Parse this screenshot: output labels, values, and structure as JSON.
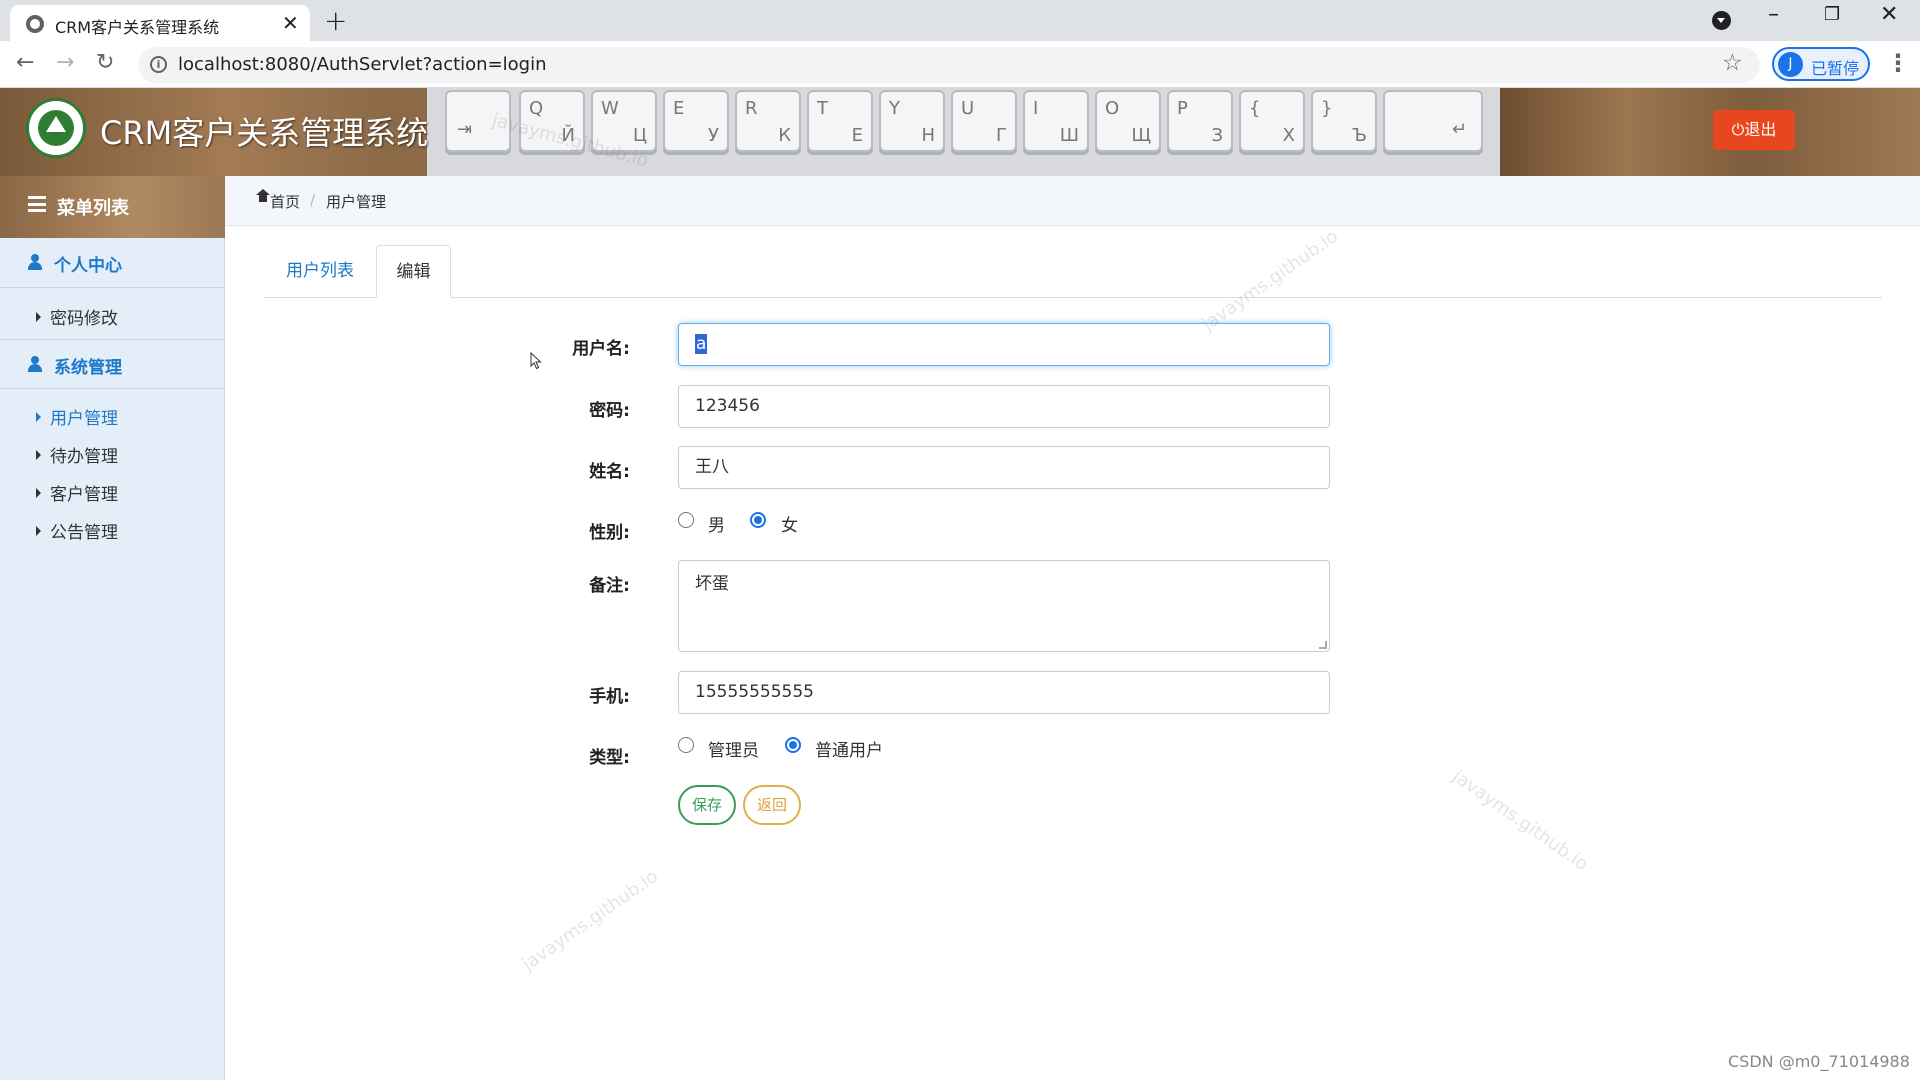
{
  "browser": {
    "tab_title": "CRM客户关系管理系统",
    "url": "localhost:8080/AuthServlet?action=login",
    "profile_initial": "J",
    "profile_status": "已暂停"
  },
  "header": {
    "app_title": "CRM客户关系管理系统",
    "logout_label": "退出"
  },
  "sidebar": {
    "menu_title": "菜单列表",
    "sections": [
      {
        "label": "个人中心",
        "items": [
          {
            "label": "密码修改"
          }
        ]
      },
      {
        "label": "系统管理",
        "items": [
          {
            "label": "用户管理",
            "active": true
          },
          {
            "label": "待办管理"
          },
          {
            "label": "客户管理"
          },
          {
            "label": "公告管理"
          }
        ]
      }
    ]
  },
  "breadcrumb": {
    "home": "首页",
    "current": "用户管理"
  },
  "tabs": [
    {
      "label": "用户列表"
    },
    {
      "label": "编辑",
      "active": true
    }
  ],
  "form": {
    "username": {
      "label": "用户名:",
      "value": "a"
    },
    "password": {
      "label": "密码:",
      "value": "123456"
    },
    "name": {
      "label": "姓名:",
      "value": "王八"
    },
    "gender": {
      "label": "性别:",
      "options": [
        "男",
        "女"
      ],
      "selected": "女"
    },
    "remark": {
      "label": "备注:",
      "value": "坏蛋"
    },
    "phone": {
      "label": "手机:",
      "value": "15555555555"
    },
    "type": {
      "label": "类型:",
      "options": [
        "管理员",
        "普通用户"
      ],
      "selected": "普通用户"
    },
    "save_label": "保存",
    "back_label": "返回"
  },
  "watermark_text": "javayms.github.io",
  "footer_credit": "CSDN @m0_71014988",
  "colors": {
    "accent_blue": "#1f78c8",
    "logout_red": "#e8461f",
    "save_green": "#3c9a5f",
    "back_orange": "#e0b04a"
  }
}
